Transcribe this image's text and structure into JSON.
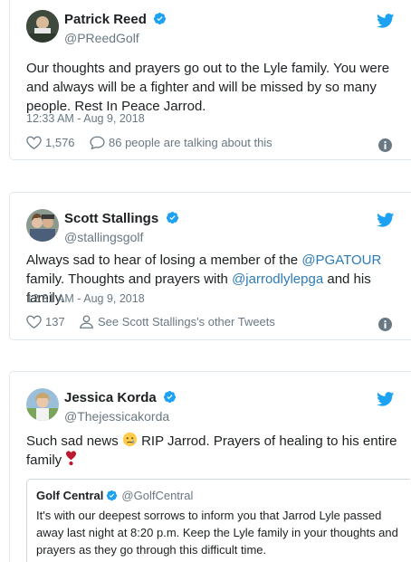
{
  "tweets": [
    {
      "name": "Patrick Reed",
      "handle": "@PReedGolf",
      "text": "Our thoughts and prayers go out to the Lyle family. You were and always will be a fighter and will be missed by so many people. Rest In Peace Jarrod.",
      "date": "12:33 AM - Aug 9, 2018",
      "likes": "1,576",
      "talk": "86 people are talking about this"
    },
    {
      "name": "Scott Stallings",
      "handle": "@stallingsgolf",
      "text_part1": "Always sad to hear of losing a member of the ",
      "mention1": "@PGATOUR",
      "text_part2": " family. Thoughts and prayers with ",
      "mention2": "@jarrodlylepga",
      "text_part3": " and his family.",
      "date": "12:31 AM - Aug 9, 2018",
      "likes": "137",
      "other": "See Scott Stallings's other Tweets"
    },
    {
      "name": "Jessica Korda",
      "handle": "@Thejessicakorda",
      "text_part1": "Such sad news ",
      "text_part2": " RIP Jarrod. Prayers of healing to his entire family ",
      "quote": {
        "name": "Golf Central",
        "handle": "@GolfCentral",
        "text": "It's with our deepest sorrows to inform you that Jarrod Lyle passed away last night at 8:20 p.m. Keep the Lyle family in your thoughts and prayers as they go through this difficult time."
      }
    }
  ],
  "colors": {
    "twitter_blue": "#1da1f2",
    "link": "#2b7bb9",
    "muted": "#697882",
    "border": "#e1e8ed"
  },
  "icons": [
    "twitter-bird-icon",
    "verified-badge-icon",
    "heart-icon",
    "comment-icon",
    "person-icon",
    "info-icon",
    "crying-face-emoji",
    "heart-emoji"
  ]
}
